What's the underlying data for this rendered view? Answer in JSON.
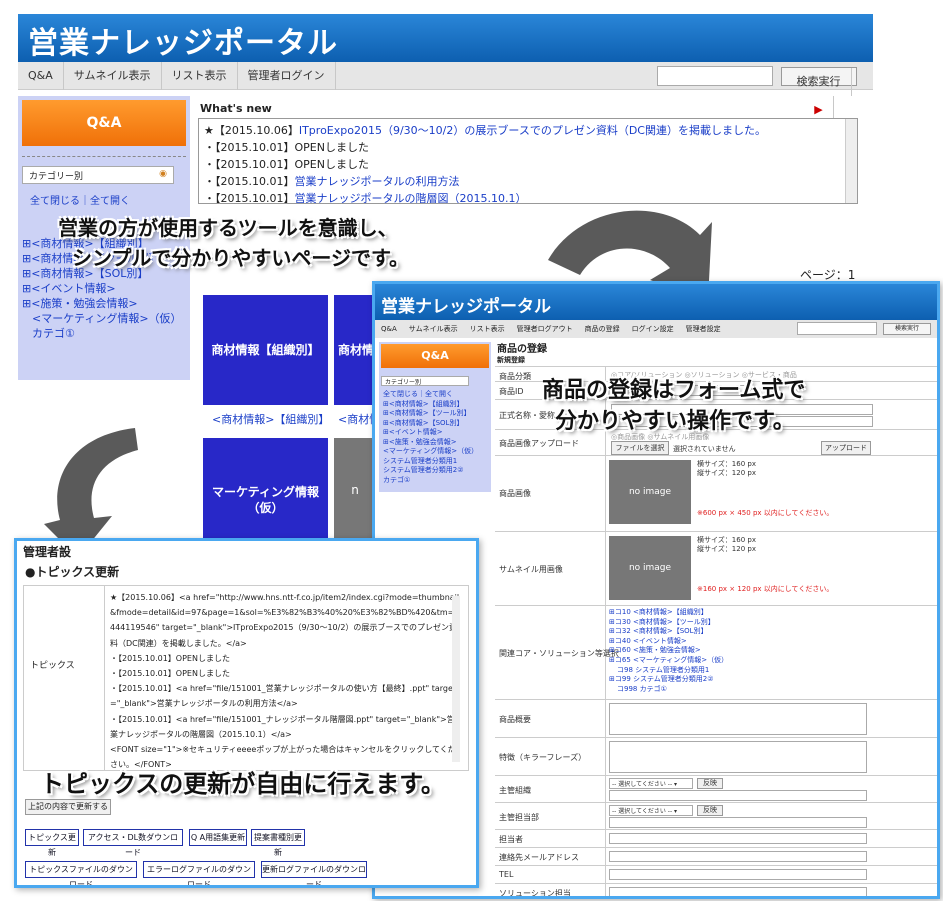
{
  "top": {
    "title": "営業ナレッジポータル",
    "nav": [
      "Q&A",
      "サムネイル表示",
      "リスト表示",
      "管理者ログイン"
    ],
    "search_button": "検索実行"
  },
  "sidebar": {
    "qa_label": "Q&A",
    "category_select": "カテゴリー別",
    "expand_collapse": "全て閉じる｜全て開く",
    "tree": [
      "⊞<商材情報>【組織別】",
      "⊞<商材情報>【ツール別】",
      "⊞<商材情報>【SOL別】",
      "⊞<イベント情報>",
      "⊞<施策・勉強会情報>",
      "<マーケティング情報>（仮）",
      "カテゴ①"
    ]
  },
  "news": {
    "heading": "What's new",
    "items": [
      {
        "date": "★【2015.10.06】",
        "text": "ITproExpo2015（9/30〜10/2）の展示ブースでのプレゼン資料（DC関連）を掲載しました。",
        "link": true
      },
      {
        "date": "・【2015.10.01】",
        "text": "OPENしました",
        "link": false
      },
      {
        "date": "・【2015.10.01】",
        "text": "OPENしました",
        "link": false
      },
      {
        "date": "・【2015.10.01】",
        "text": "営業ナレッジポータルの利用方法",
        "link": true
      },
      {
        "date": "・【2015.10.01】",
        "text": "営業ナレッジポータルの階層図（2015.10.1）",
        "link": true
      }
    ]
  },
  "captions": {
    "c1_line1": "営業の方が使用するツールを意識し、",
    "c1_line2": "シンプルで分かりやすいページです。",
    "c2_line1": "商品の登録はフォーム式で",
    "c2_line2": "分かりやすい操作です。",
    "c3": "トピックスの更新が自由に行えます。"
  },
  "page_label": "ページ：1",
  "tiles": {
    "t1": "商材情報【組織別】",
    "t2": "商材情",
    "t1_link": "<商材情報>【組織別】",
    "t2_link": "<商材情",
    "t3_line1": "マーケティング情報",
    "t3_line2": "（仮）",
    "t4": "n"
  },
  "register": {
    "title": "営業ナレッジポータル",
    "nav": [
      "Q&A",
      "サムネイル表示",
      "リスト表示",
      "管理者ログアウト",
      "商品の登録",
      "ログイン設定",
      "管理者設定"
    ],
    "search_button": "検索実行",
    "qa": "Q&A",
    "category": "カテゴリー別",
    "side_links": [
      "全て閉じる｜全て開く",
      "⊞<商材情報>【組織別】",
      "⊞<商材情報>【ツール別】",
      "⊞<商材情報>【SOL別】",
      "⊞<イベント情報>",
      "⊞<施策・勉強会情報>",
      "<マーケティング情報>（仮）",
      "システム管理者分類用1",
      "システム管理者分類用2②",
      "カテゴ①"
    ],
    "heading": "商品の登録",
    "subheading": "新規登録",
    "fields": {
      "category": "商品分類",
      "category_opts": "◎コア/ソリューション ◎ソリューション ◎サービス・商品",
      "id": "商品ID",
      "name": "正式名称・愛称",
      "image_upload": "商品画像アップロード",
      "upload_opts": "◎商品画像 ◎サムネイル用画像",
      "choose_file": "ファイルを選択",
      "no_file": "選択されていません",
      "upload_btn": "アップロード",
      "product_image": "商品画像",
      "no_image": "no image",
      "img_size": "横サイズ：160 px\n縦サイズ：120 px",
      "img_note": "※600 px × 450 px 以内にしてください。",
      "thumb_image": "サムネイル用画像",
      "thumb_note": "※160 px × 120 px 以内にしてください。",
      "related": "関連コア・ソリューション等選択",
      "related_list": [
        "⊞コ10 <商材情報>【組織別】",
        "⊞コ30 <商材情報>【ツール別】",
        "⊞コ32 <商材情報>【SOL別】",
        "⊞コ40 <イベント情報>",
        "⊞コ60 <施策・勉強会情報>",
        "⊞コ65 <マーケティング情報>（仮）",
        "コ98 システム管理者分類用1",
        "⊞コ99 システム管理者分類用2②",
        "コ998 カテゴ①"
      ],
      "summary": "商品概要",
      "features": "特徴（キラーフレーズ）",
      "main_org": "主管組織",
      "main_dept": "主管担当部",
      "select_placeholder": "-- 選択してください -- ▾",
      "apply": "反映",
      "person": "担当者",
      "email": "連絡先メールアドレス",
      "tel": "TEL",
      "sol_person": "ソリューション担当"
    }
  },
  "admin": {
    "title": "管理者設",
    "section": "●トピックス更新",
    "label": "トピックス",
    "content": "★【2015.10.06】<a href=\"http://www.hns.ntt-f.co.jp/item2/index.cgi?mode=thumbnail&fmode=detail&id=97&page=1&sol=%E3%82%B3%40%20%E3%82%BD%420&tm=1444119546\" target=\"_blank\">ITproExpo2015（9/30〜10/2）の展示ブースでのプレゼン資料（DC関連）を掲載しました。</a>\n・【2015.10.01】OPENしました\n・【2015.10.01】OPENしました\n・【2015.10.01】<a href=\"file/151001_営業ナレッジポータルの使い方【最終】.ppt\" target=\"_blank\">営業ナレッジポータルの利用方法</a>\n・【2015.10.01】<a href=\"file/151001_ナレッジポータル階層図.ppt\" target=\"_blank\">営業ナレッジポータルの階層図（2015.10.1）</a>\n<FONT size=\"1\">※セキュリティeeeeポップが上がった場合はキャンセルをクリックしてください。</FONT>",
    "update_button": "上記の内容で更新する",
    "buttons_row1": [
      "トピックス更新",
      "アクセス・DL数ダウンロード",
      "Q A用語集更新",
      "提案書種別更新"
    ],
    "buttons_row2": [
      "トピックスファイルのダウンロード",
      "エラーログファイルのダウンロード",
      "更新ログファイルのダウンロード"
    ]
  }
}
